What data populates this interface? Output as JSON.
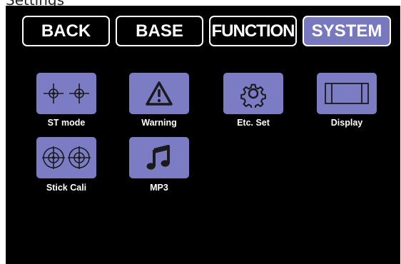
{
  "caption": "Settings",
  "tabs": [
    {
      "label": "BACK",
      "active": false
    },
    {
      "label": "BASE",
      "active": false
    },
    {
      "label": "FUNCTION",
      "active": false
    },
    {
      "label": "SYSTEM",
      "active": true
    }
  ],
  "items": [
    {
      "label": "ST mode",
      "icon": "crosshair-pair-icon"
    },
    {
      "label": "Warning",
      "icon": "warning-triangle-icon"
    },
    {
      "label": "Etc. Set",
      "icon": "gear-icon"
    },
    {
      "label": "Display",
      "icon": "display-icon"
    },
    {
      "label": "Stick Cali",
      "icon": "target-pair-icon"
    },
    {
      "label": "MP3",
      "icon": "music-note-icon"
    }
  ],
  "colors": {
    "screen_bg": "#000000",
    "tile": "#7c7cc4",
    "active_tab": "#7878c0",
    "icon": "#1a1a1a",
    "text": "#ffffff"
  }
}
